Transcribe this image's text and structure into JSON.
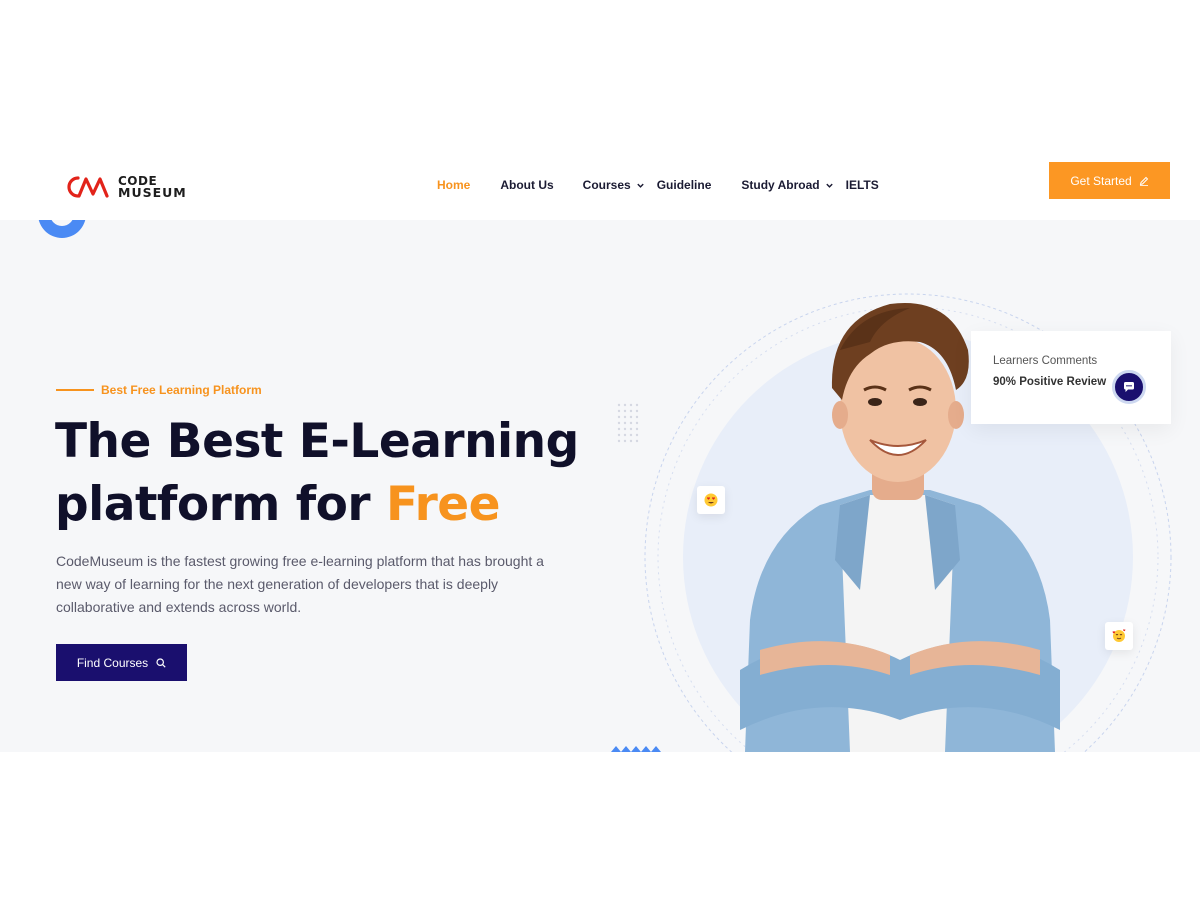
{
  "brand": {
    "name_line1": "CODE",
    "name_line2": "MUSEUM",
    "mark_color": "#e2231a",
    "accent": "#f7931e",
    "primary": "#1a0f6e"
  },
  "nav": {
    "items": [
      {
        "label": "Home",
        "active": true,
        "dropdown": false
      },
      {
        "label": "About Us",
        "active": false,
        "dropdown": false
      },
      {
        "label": "Courses",
        "active": false,
        "dropdown": true
      },
      {
        "label": "Guideline",
        "active": false,
        "dropdown": false
      },
      {
        "label": "Study Abroad",
        "active": false,
        "dropdown": true
      },
      {
        "label": "IELTS",
        "active": false,
        "dropdown": false
      }
    ],
    "cta_label": "Get Started",
    "cta_icon": "pencil-icon"
  },
  "hero": {
    "tagline": "Best Free Learning Platform",
    "headline_line1": "The Best E-Learning",
    "headline_line2_prefix": "platform for ",
    "headline_accent": "Free",
    "description": "CodeMuseum is the fastest growing free e-learning platform that has brought a new way of learning for the next generation of developers that is deeply collaborative and extends across world.",
    "button_label": "Find Courses",
    "button_icon": "search-icon"
  },
  "review_card": {
    "label": "Learners Comments",
    "value": "90% Positive Review",
    "icon": "chat-bubble-icon"
  },
  "decorations": {
    "emoji_badges": [
      "heart-eyes-emoji-icon",
      "hearts-face-emoji-icon"
    ],
    "student_photo": "smiling-student-photo"
  }
}
